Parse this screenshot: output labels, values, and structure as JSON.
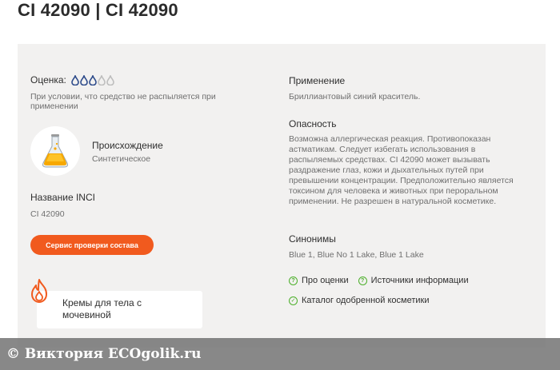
{
  "header": {
    "title": "CI 42090 | CI 42090"
  },
  "rating": {
    "label": "Оценка:",
    "filled": 3,
    "total": 5,
    "note": "При условии, что средство не распыляется при применении"
  },
  "origin": {
    "title": "Происхождение",
    "value": "Синтетическое"
  },
  "inci": {
    "title": "Название INCI",
    "value": "CI 42090"
  },
  "service_button": {
    "label": "Сервис проверки состава"
  },
  "product_card": {
    "label": "Кремы для тела с мочевиной"
  },
  "usage": {
    "title": "Применение",
    "text": "Бриллиантовый синий краситель."
  },
  "danger": {
    "title": "Опасность",
    "text": "Возможна аллергическая реакция. Противопоказан астматикам. Следует избегать использования в распыляемых средствах. CI 42090 может вызывать раздражение глаз, кожи и дыхательных путей при превышении концентрации. Предположительно является токсином для человека и животных при пероральном применении. Не разрешен в натуральной косметике."
  },
  "synonyms": {
    "title": "Синонимы",
    "text": "Blue 1, Blue No 1 Lake, Blue 1 Lake"
  },
  "links": {
    "about_ratings": "Про оценки",
    "sources": "Источники информации",
    "catalog": "Каталог одобренной косметики"
  },
  "watermark": {
    "text": "© Виктория  ECOgolik.ru"
  },
  "colors": {
    "accent": "#f15a1e",
    "drop_filled": "#2c4a8a",
    "drop_empty": "#bdbdbd",
    "check": "#4caf2a",
    "card_bg": "#f2f1f0"
  },
  "icons": {
    "drop": "drop-icon",
    "flask": "flask-icon",
    "flame": "flame-icon",
    "question": "question-icon",
    "check": "check-icon"
  }
}
